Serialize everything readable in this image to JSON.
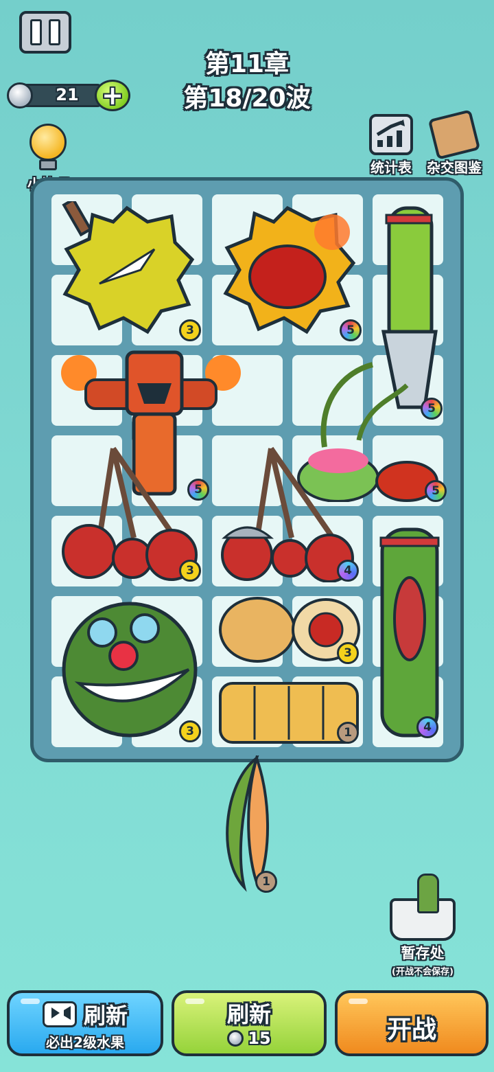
{
  "hud": {
    "chapter": "第11章",
    "wave": "第18/20波",
    "coins": "21",
    "plus": "+"
  },
  "top_buttons": {
    "tips": "小技巧",
    "stats": "统计表",
    "codex": "杂交图鉴"
  },
  "board": {
    "items": [
      {
        "name": "durian",
        "level": "3"
      },
      {
        "name": "flaming-durian",
        "level": "5"
      },
      {
        "name": "angry-cucumber-knife",
        "level": "5"
      },
      {
        "name": "fire-golem",
        "level": "5"
      },
      {
        "name": "vine-pumpkin-creature",
        "level": "5"
      },
      {
        "name": "angry-cherries",
        "level": "3"
      },
      {
        "name": "armored-cherries",
        "level": "4"
      },
      {
        "name": "screaming-cucumber",
        "level": "4"
      },
      {
        "name": "clown-watermelon",
        "level": "3"
      },
      {
        "name": "melon-eye",
        "level": "3"
      },
      {
        "name": "pumpkin",
        "level": "1"
      }
    ]
  },
  "held_item": {
    "name": "melon-slice",
    "level": "1"
  },
  "storage": {
    "label": "暂存处",
    "note": "(开战不会保存)"
  },
  "buttons": {
    "ad_refresh_main": "刷新",
    "ad_refresh_sub": "必出2级水果",
    "refresh_main": "刷新",
    "refresh_cost": "15",
    "start": "开战"
  },
  "colors": {
    "background": "#7fd8d2",
    "board": "#5e9db0",
    "cell": "#e7f7f6",
    "ad_button": "#29a9ef",
    "refresh_button": "#95d33a",
    "start_button": "#f08a1e"
  }
}
